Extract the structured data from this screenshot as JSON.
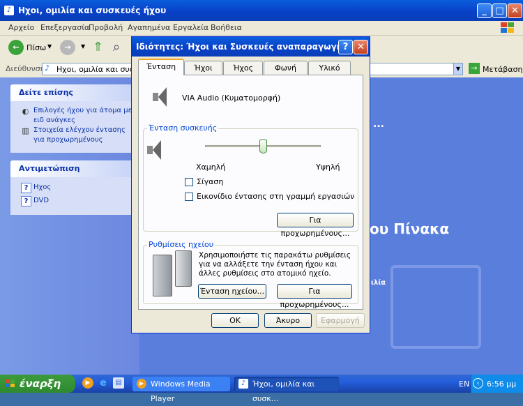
{
  "explorer": {
    "title": "Ηχοι, ομιλία και συσκευές ήχου",
    "menu": [
      "Αρχείο",
      "Επεξεργασία",
      "Προβολή",
      "Αγαπημένα",
      "Εργαλεία",
      "Βοήθεια"
    ],
    "back_label": "Πίσω",
    "address_label": "Διεύθυνση",
    "address_value": "Ηχοι, ομιλία και συσκευ",
    "go_label": "Μετάβαση",
    "see_also": {
      "title": "Δείτε επίσης",
      "links": [
        "Επιλογές ήχου για άτομα με ειδ ανάγκες",
        "Στοιχεία ελέγχου έντασης για προχωρημένους"
      ]
    },
    "troubleshoot": {
      "title": "Αντιμετώπιση προβλημάτων",
      "links": [
        "Ηχος",
        "DVD"
      ]
    },
    "bg_text_1": "...",
    "bg_text_2": "ου Πίνακα",
    "bg_text_3": "ιλία"
  },
  "dialog": {
    "title": "Ιδιότητες: Ήχοι και Συσκευές αναπαραγωγής",
    "help_button": "?",
    "close_button": "✕",
    "tabs": [
      "Ένταση",
      "Ήχοι",
      "Ήχος",
      "Φωνή",
      "Υλικό"
    ],
    "device_name": "VIA Audio (Κυματομορφή)",
    "device_volume_group": "Ένταση συσκευής",
    "slider_low": "Χαμηλή",
    "slider_high": "Υψηλή",
    "slider_value": 0.5,
    "mute_label": "Σίγαση",
    "tray_icon_label": "Εικονίδιο έντασης στη γραμμή εργασιών",
    "advanced_button": "Για προχωρημένους...",
    "speaker_group": "Ρυθμίσεις ηχείου",
    "speaker_desc": "Χρησιμοποιήστε τις παρακάτω ρυθμίσεις για να αλλάξετε την ένταση ήχου και άλλες ρυθμίσεις στο ατομικό ηχείο.",
    "speaker_volume_button": "Ένταση ηχείου...",
    "speaker_advanced_button": "Για προχωρημένους...",
    "ok": "OK",
    "cancel": "Άκυρο",
    "apply": "Εφαρμογή"
  },
  "taskbar": {
    "start": "έναρξη",
    "tasks": [
      "Windows Media Player",
      "Ήχοι, ομιλία και συσκ..."
    ],
    "lang": "EN",
    "clock": "6:56 μμ"
  },
  "colors": {
    "accent": "#0a5fdc",
    "start": "#3c9a3c",
    "link": "#0c32a8"
  }
}
